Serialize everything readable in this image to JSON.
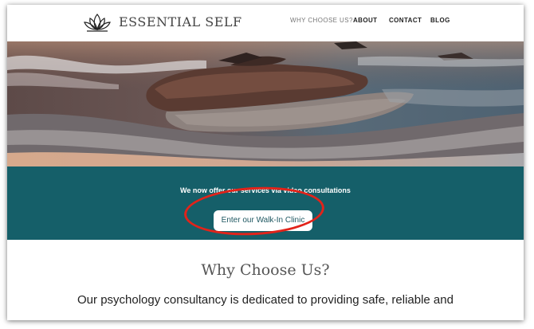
{
  "header": {
    "brand": "ESSENTIAL SELF",
    "nav": [
      "WHY CHOOSE US?",
      "ABOUT",
      "CONTACT",
      "BLOG"
    ],
    "active_nav": "WHY CHOOSE US?"
  },
  "band": {
    "text": "We now offer our services via video consultations",
    "cta_label": "Enter our Walk-In Clinic"
  },
  "content": {
    "title": "Why Choose Us?",
    "body": "Our psychology consultancy is dedicated to providing safe, reliable and"
  },
  "colors": {
    "band": "#155f69",
    "highlight": "#e2231a"
  }
}
